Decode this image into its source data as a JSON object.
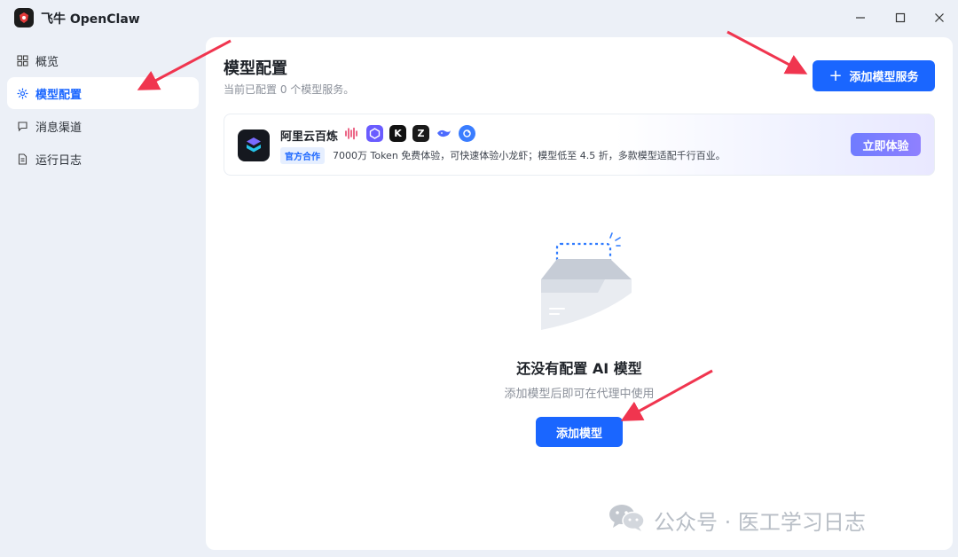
{
  "window": {
    "title": "飞牛 OpenClaw",
    "controls": [
      "minimize-icon",
      "maximize-icon",
      "close-icon"
    ]
  },
  "sidebar": {
    "items": [
      {
        "label": "概览",
        "icon": "grid-icon",
        "active": false
      },
      {
        "label": "模型配置",
        "icon": "gear-icon",
        "active": true
      },
      {
        "label": "消息渠道",
        "icon": "chat-icon",
        "active": false
      },
      {
        "label": "运行日志",
        "icon": "document-icon",
        "active": false
      }
    ]
  },
  "main": {
    "title": "模型配置",
    "subtitle": "当前已配置 0 个模型服务。",
    "add_service_label": "添加模型服务",
    "banner": {
      "name": "阿里云百炼",
      "tag": "官方合作",
      "description": "7000万 Token 免费体验，可快速体验小龙虾；模型低至 4.5 折，多款模型适配千行百业。",
      "partner_icons": [
        "waveform-icon",
        "hexagon-icon",
        "k-icon",
        "z-icon",
        "whale-icon",
        "circle-icon"
      ],
      "button_label": "立即体验"
    },
    "empty_state": {
      "title": "还没有配置 AI 模型",
      "subtitle": "添加模型后即可在代理中使用",
      "button_label": "添加模型"
    }
  },
  "watermark": {
    "text": "公众号 · 医工学习日志"
  },
  "colors": {
    "accent": "#1a66ff",
    "annotation_arrow": "#f0354f",
    "background": "#ecf0f7"
  }
}
